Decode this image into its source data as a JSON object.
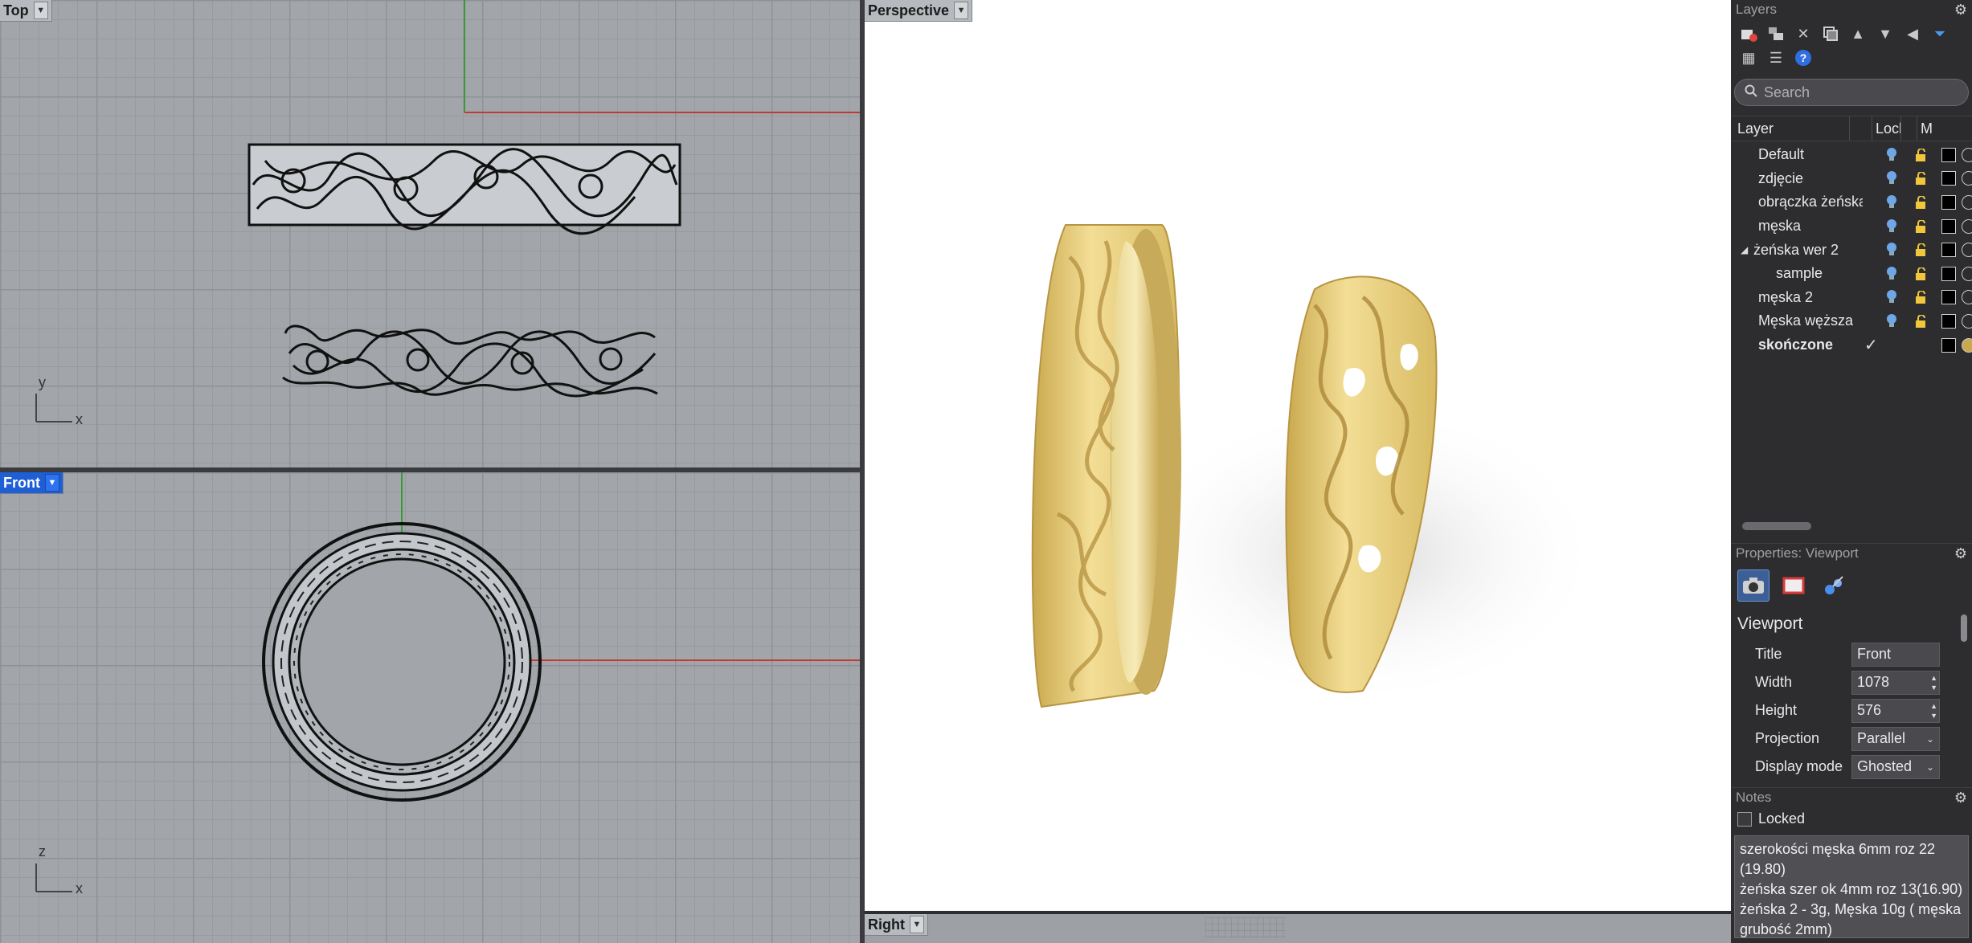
{
  "viewports": {
    "top": {
      "label": "Top",
      "axis_y": "y",
      "axis_x": "x"
    },
    "front": {
      "label": "Front",
      "axis_y": "z",
      "axis_x": "x"
    },
    "perspective": {
      "label": "Perspective"
    },
    "right": {
      "label": "Right"
    }
  },
  "layers_panel": {
    "title": "Layers",
    "search_placeholder": "Search",
    "columns": {
      "layer": "Layer",
      "lock": "Lock",
      "m": "M"
    },
    "rows": [
      {
        "name": "Default"
      },
      {
        "name": "zdjęcie"
      },
      {
        "name": "obrączka żeńska"
      },
      {
        "name": "męska"
      },
      {
        "name": "żeńska wer 2"
      },
      {
        "name": "sample"
      },
      {
        "name": "męska 2"
      },
      {
        "name": "Męska węższa"
      },
      {
        "name": "skończone"
      }
    ]
  },
  "properties_panel": {
    "title": "Properties: Viewport",
    "section": "Viewport",
    "fields": {
      "title": {
        "label": "Title",
        "value": "Front"
      },
      "width": {
        "label": "Width",
        "value": "1078"
      },
      "height": {
        "label": "Height",
        "value": "576"
      },
      "projection": {
        "label": "Projection",
        "value": "Parallel"
      },
      "display_mode": {
        "label": "Display mode",
        "value": "Ghosted"
      }
    }
  },
  "notes_panel": {
    "title": "Notes",
    "locked_label": "Locked",
    "lines": [
      "szerokości męska 6mm roz 22 (19.80)",
      "żeńska szer ok 4mm roz 13(16.90)",
      "żeńska 2 - 3g, Męska 10g ( męska grubość 2mm)"
    ]
  },
  "colors": {
    "active_viewport": "#1f5fd6",
    "gold": "#e8cf7e",
    "x_axis": "#c0392b",
    "y_axis": "#2e9e3c"
  }
}
